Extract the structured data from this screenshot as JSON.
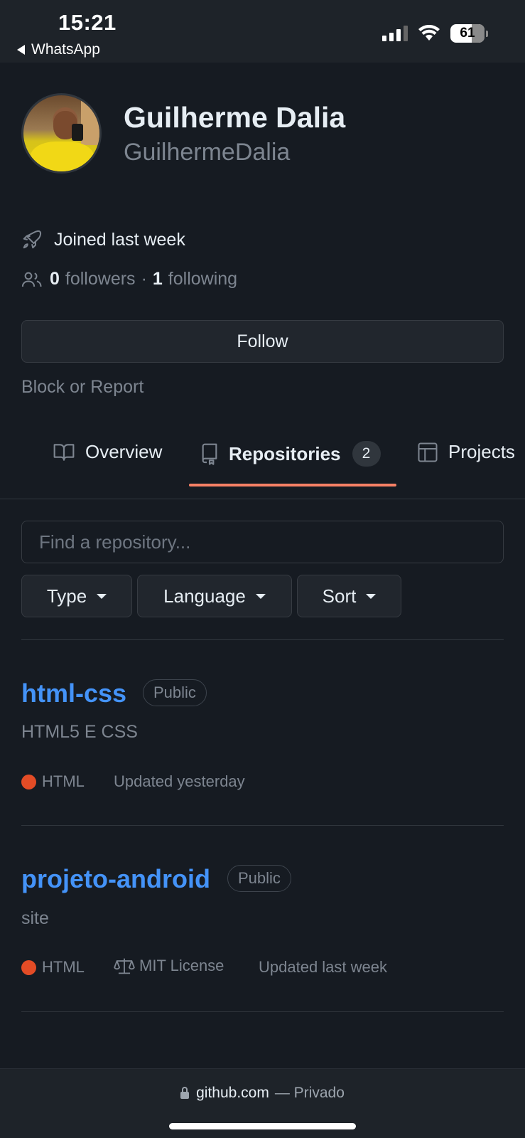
{
  "status_bar": {
    "time": "15:21",
    "back_app": "WhatsApp",
    "battery": "61",
    "icons": [
      "signal-icon",
      "wifi-icon",
      "battery-icon"
    ]
  },
  "profile": {
    "full_name": "Guilherme Dalia",
    "username": "GuilhermeDalia",
    "joined": "Joined last week",
    "followers_count": "0",
    "followers_label": "followers",
    "separator": "·",
    "following_count": "1",
    "following_label": "following",
    "follow_button": "Follow",
    "block_report": "Block or Report"
  },
  "tabs": [
    {
      "label": "Overview",
      "icon": "book-icon"
    },
    {
      "label": "Repositories",
      "icon": "repo-icon",
      "count": "2",
      "active": true
    },
    {
      "label": "Projects",
      "icon": "table-icon"
    }
  ],
  "search": {
    "placeholder": "Find a repository..."
  },
  "filters": [
    {
      "label": "Type"
    },
    {
      "label": "Language"
    },
    {
      "label": "Sort"
    }
  ],
  "repos": [
    {
      "name": "html-css",
      "visibility": "Public",
      "description": "HTML5 E CSS",
      "language": "HTML",
      "language_color": "#e34c26",
      "updated": "Updated yesterday"
    },
    {
      "name": "projeto-android",
      "visibility": "Public",
      "description": "site",
      "language": "HTML",
      "language_color": "#e34c26",
      "license": "MIT License",
      "updated": "Updated last week"
    }
  ],
  "browser_bar": {
    "domain": "github.com",
    "suffix": "— Privado"
  },
  "colors": {
    "background": "#161b22",
    "link": "#4493f8",
    "tab_underline": "#f78166"
  }
}
